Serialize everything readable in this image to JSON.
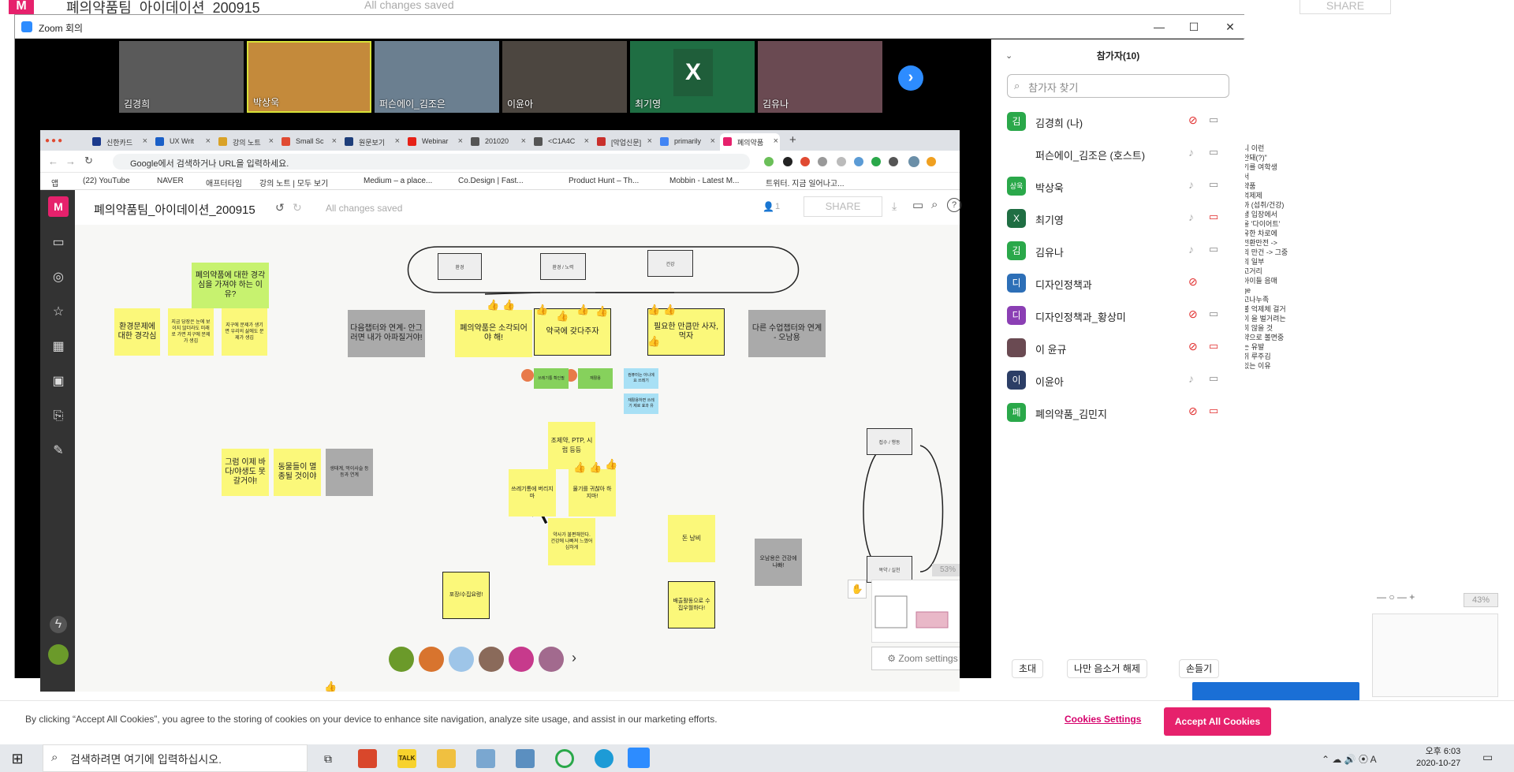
{
  "background_app": {
    "title": "폐의약품팀_아이데이션_200915",
    "saved": "All changes saved",
    "share": "SHARE",
    "notes": [
      "니 이런",
      "안돼(?)\"",
      "기를 여학생",
      "서",
      "약품",
      "억제제",
      "까 (섭취/건강)",
      "생 입장에서",
      "을 '다이어트'",
      "유한 차로에",
      "전환만전 ->",
      "의 만건 -> 그중",
      "의 일부",
      "고거리",
      "아이들 음매",
      "ge",
      "고나누족",
      "불 억제체 걸거",
      "이 을 벌거려는",
      "히 않을 것",
      "약으로 볼면중",
      "는 유발",
      "쥐 루주김",
      "있는 이유"
    ],
    "zoom_pct": "43%"
  },
  "zoom_window": {
    "title": "Zoom 회의",
    "minimize": "—",
    "maximize": "☐",
    "close": "✕",
    "thumbnails": [
      {
        "name": "김경희",
        "muted": true,
        "color": "#5a5a5a"
      },
      {
        "name": "박상욱",
        "muted": false,
        "color": "#c48a3b"
      },
      {
        "name": "퍼슨에이_김조은",
        "muted": false,
        "color": "#6b7f90"
      },
      {
        "name": "이윤아",
        "muted": false,
        "color": "#4c4640"
      },
      {
        "name": "최기영",
        "muted": false,
        "color": "#1f6e43",
        "letter": "X"
      },
      {
        "name": "김유나",
        "muted": false,
        "color": "#6a4a52"
      }
    ],
    "next_arrow": "›"
  },
  "browser": {
    "tabs": [
      {
        "label": "신한카드",
        "color": "#1b3a8c"
      },
      {
        "label": "UX Writ",
        "color": "#1a5fc7"
      },
      {
        "label": "강의 노트",
        "color": "#d9a227"
      },
      {
        "label": "Small Sc",
        "color": "#e04a32"
      },
      {
        "label": "원문보기",
        "color": "#1d3d7a"
      },
      {
        "label": "Webinar",
        "color": "#e62117"
      },
      {
        "label": "201020",
        "color": "#555555"
      },
      {
        "label": "<C1A4C",
        "color": "#555555"
      },
      {
        "label": "[악업신문]",
        "color": "#c9302c"
      },
      {
        "label": "primarily",
        "color": "#4285f4"
      },
      {
        "label": "폐의약품",
        "color": "#e6216c"
      }
    ],
    "new_tab": "+",
    "omnibox": "Google에서 검색하거나 URL을 입력하세요.",
    "bookmarks": [
      "앱",
      "(22) YouTube",
      "NAVER",
      "애프터타임",
      "강의 노트 | 모두 보기",
      "Medium – a place...",
      "Co.Design | Fast...",
      "Product Hunt – Th...",
      "Mobbin - Latest M...",
      "트위터. 지금 일어나고..."
    ]
  },
  "mural": {
    "logo": "M",
    "title": "폐의약품팀_아이데이션_200915",
    "saved": "All changes saved",
    "share": "SHARE",
    "user_count": "1",
    "zoom_settings": "⚙ Zoom settings",
    "mini_pct": "53%",
    "notes": {
      "q": "폐의약품에 대한 경각심을 가져야 하는 이유?",
      "n1": "환경문제에 대한 경각심",
      "n2": "지금 당장은 눈에 보이지 않더라도 미래로 가면 지구에 문제가 생김",
      "n3": "지구에 문제가 생기면 우리의 삶에도 문제가 생김",
      "n4": "다음챕터와 연계- 안그러면 내가 아파질거야!",
      "n5": "폐의약품은 소각되어야 해!",
      "n6": "약국에 갖다주자",
      "n7": "필요한 만큼만 사자, 먹자",
      "n8": "다른 수업챕터와 연계 - 오남용",
      "n9": "그럼 이제 바다/야생도 못갈거야!",
      "n10": "동물들이 멸종될 것이야",
      "n11": "생태계, 먹이사슬 등등과 연계",
      "n12": "조제약, PTP, 시럽 등등",
      "n13": "쓰레기통에 버리지마",
      "n14": "물기를 귀찮아 하지마!",
      "n15": "약사가 불편해한다. 건강에 나빠져 느꼈어 심하게",
      "n16": "돈 낭비",
      "n17": "오남용은 건강에 나빠!",
      "n18": "포장/수집요령!",
      "n19": "배출활동으로 수집우월하다!",
      "s1": "쓰레기통 확인필",
      "s2": "재활용",
      "s3": "컴퓨터는 아니에요 쓰레기",
      "s4": "재활용하면 쓰레기 제로 효과 유",
      "d1": "환경",
      "d2": "환경 / 노력",
      "d3": "건강",
      "d4": "접수 / 행동",
      "d5": "복약 / 실천"
    }
  },
  "participants": {
    "title": "참가자(10)",
    "search_placeholder": "참가자 찾기",
    "list": [
      {
        "avatar": "김",
        "color": "#2aa84a",
        "name": "김경희 (나)",
        "mic": "muted",
        "cam": "on"
      },
      {
        "avatar": "",
        "color": "#ffffff",
        "name": "퍼슨에이_김조은 (호스트)",
        "mic": "on",
        "cam": "on"
      },
      {
        "avatar": "상욱",
        "color": "#2aa84a",
        "name": "박상욱",
        "mic": "on",
        "cam": "on"
      },
      {
        "avatar": "X",
        "color": "#1f6e43",
        "name": "최기영",
        "mic": "on",
        "cam": "off"
      },
      {
        "avatar": "김",
        "color": "#2aa84a",
        "name": "김유나",
        "mic": "on",
        "cam": "on"
      },
      {
        "avatar": "디",
        "color": "#2d6fb7",
        "name": "디자인정책과",
        "mic": "muted",
        "cam": "none"
      },
      {
        "avatar": "디",
        "color": "#8b3fb4",
        "name": "디자인정책과_황상미",
        "mic": "muted",
        "cam": "on"
      },
      {
        "avatar": "",
        "color": "#6a4a52",
        "name": "이 윤규",
        "mic": "muted",
        "cam": "off"
      },
      {
        "avatar": "이",
        "color": "#2c3e66",
        "name": "이윤아",
        "mic": "on",
        "cam": "on"
      },
      {
        "avatar": "폐",
        "color": "#2aa84a",
        "name": "폐의약품_김민지",
        "mic": "muted",
        "cam": "off"
      }
    ],
    "invite": "초대",
    "unmute_me": "나만 음소거 해제",
    "raise_hand": "손들기"
  },
  "cookie_banner": {
    "text": "By clicking “Accept All Cookies”, you agree to the storing of cookies on your device to enhance site navigation, analyze site usage, and assist in our marketing efforts.",
    "settings": "Cookies Settings",
    "accept": "Accept All Cookies"
  },
  "taskbar": {
    "search_placeholder": "검색하려면 여기에 입력하십시오.",
    "time": "오후 6:03",
    "date": "2020-10-27",
    "talk_label": "TALK"
  }
}
